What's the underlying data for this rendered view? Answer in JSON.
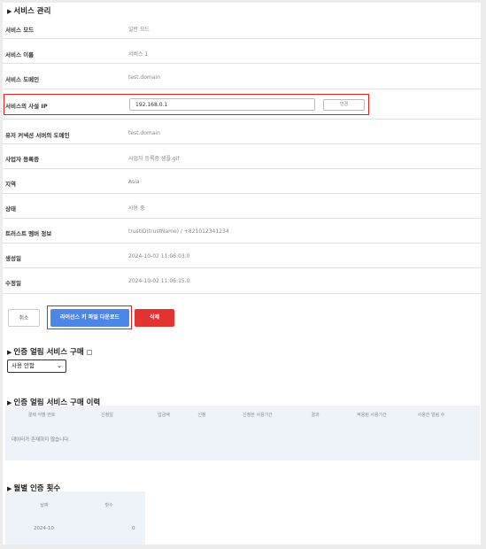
{
  "service_section": {
    "title": "서비스 관리",
    "rows": [
      {
        "label": "서비스 모드",
        "value": "일반 모드"
      },
      {
        "label": "서비스 이름",
        "value": "서비스 1"
      },
      {
        "label": "서비스 도메인",
        "value": "test.domain"
      },
      {
        "label": "서비스의 사설 IP",
        "value": "192.168.0.1"
      },
      {
        "label": "유저 커넥션 서버의 도메인",
        "value": "test.domain"
      },
      {
        "label": "사업자 등록증",
        "value": "사업자 등록증 샘플.gif"
      },
      {
        "label": "지역",
        "value": "Asia"
      },
      {
        "label": "상태",
        "value": "사용 중"
      },
      {
        "label": "트러스트 멤버 정보",
        "value": "trustID(trustName) / +821012341234"
      },
      {
        "label": "생성일",
        "value": "2024-10-02 11:06:03.0"
      },
      {
        "label": "수정일",
        "value": "2024-10-02 11:06:15.0"
      }
    ],
    "ip_change_button": "변경"
  },
  "actions": {
    "cancel": "취소",
    "license_download": "라이선스 키 파일 다운로드",
    "delete": "삭제"
  },
  "purchase_section": {
    "title": "인증 얼림 서비스 구매",
    "select_value": "사용 안함"
  },
  "history_section": {
    "title": "인증 얼림 서비스 구매 이력",
    "columns": [
      "결제 식별 번호",
      "신청일",
      "입금액",
      "신청",
      "신청한 사용기간",
      "결과",
      "적용된 사용기간",
      "사용한 얼림 수"
    ],
    "empty_message": "데이터가 존재하지 않습니다."
  },
  "monthly_section": {
    "title": "월별 인증 횟수",
    "columns": [
      "날짜",
      "횟수"
    ],
    "rows": [
      {
        "date": "2024-10",
        "count": "0"
      }
    ]
  }
}
